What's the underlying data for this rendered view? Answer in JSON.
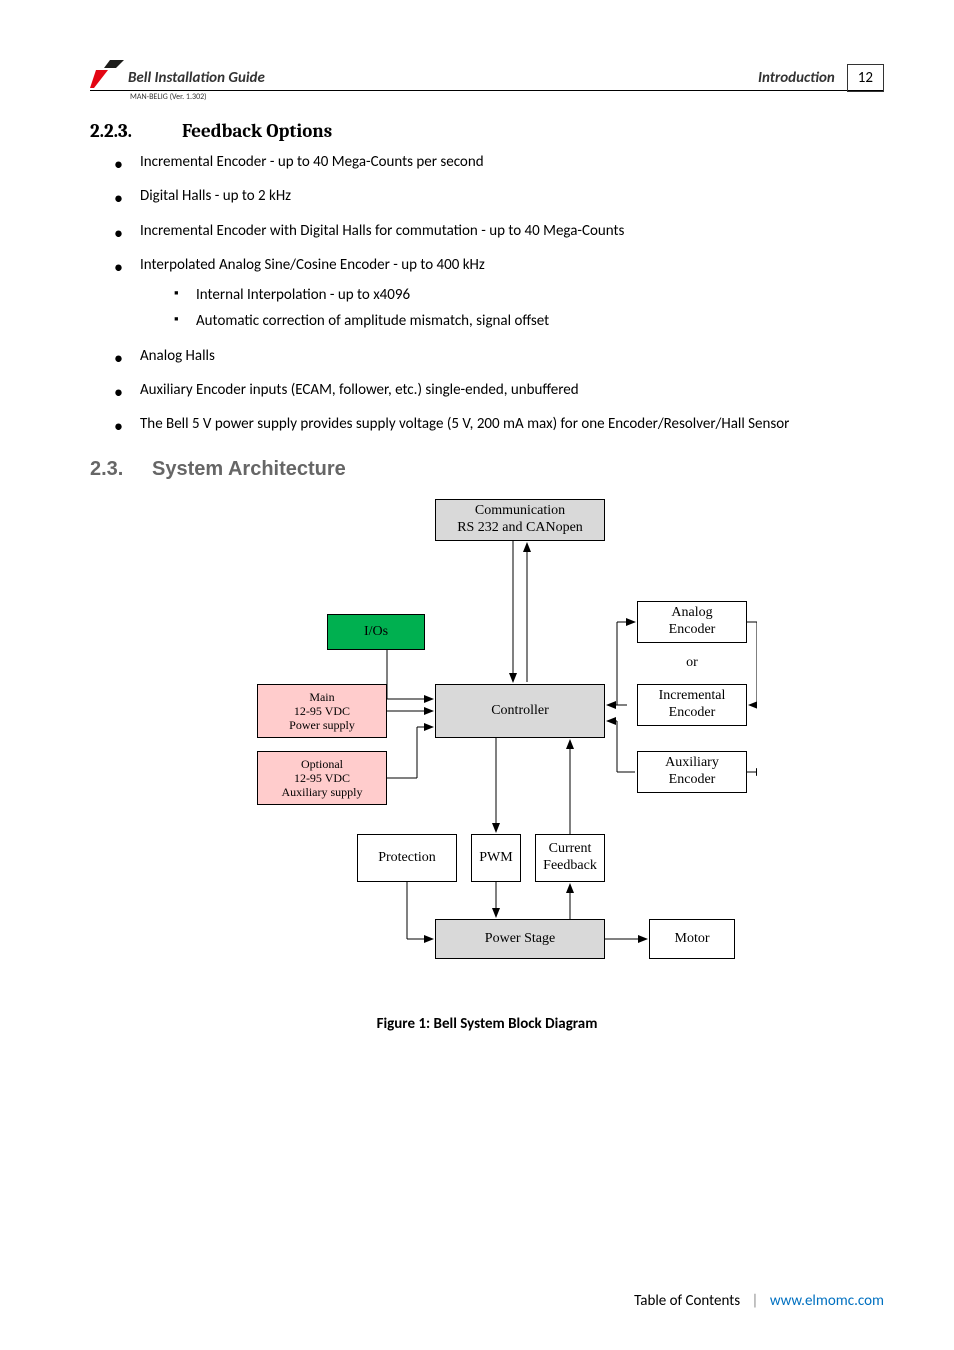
{
  "header": {
    "doc_title": "Bell Installation Guide",
    "section": "Introduction",
    "page_number": "12",
    "man_code": "MAN-BELIG (Ver. 1.302)"
  },
  "h3": {
    "number": "2.2.3.",
    "title": "Feedback Options"
  },
  "bullets": {
    "b1": "Incremental Encoder - up to 40 Mega-Counts per second",
    "b2": "Digital Halls - up to 2 kHz",
    "b3": "Incremental Encoder with Digital Halls for commutation - up to 40 Mega-Counts",
    "b4": "Interpolated Analog Sine/Cosine Encoder - up to 400 kHz",
    "b4_sub1": "Internal Interpolation - up to x4096",
    "b4_sub2": "Automatic correction of amplitude mismatch, signal offset",
    "b5": "Analog Halls",
    "b6": "Auxiliary Encoder inputs (ECAM, follower, etc.) single-ended, unbuffered",
    "b7": "The Bell 5 V power supply provides supply voltage (5 V, 200 mA max) for one Encoder/Resolver/Hall Sensor"
  },
  "h2": {
    "number": "2.3.",
    "title": "System Architecture"
  },
  "diagram": {
    "comm_line1": "Communication",
    "comm_line2": "RS 232 and CANopen",
    "ios": "I/Os",
    "main_l1": "Main",
    "main_l2": "12-95 VDC",
    "main_l3": "Power supply",
    "opt_l1": "Optional",
    "opt_l2": "12-95 VDC",
    "opt_l3": "Auxiliary supply",
    "protection": "Protection",
    "controller": "Controller",
    "pwm": "PWM",
    "current_fb_l1": "Current",
    "current_fb_l2": "Feedback",
    "power_stage": "Power Stage",
    "analog_enc_l1": "Analog",
    "analog_enc_l2": "Encoder",
    "or": "or",
    "inc_enc_l1": "Incremental",
    "inc_enc_l2": "Encoder",
    "aux_enc_l1": "Auxiliary",
    "aux_enc_l2": "Encoder",
    "motor": "Motor"
  },
  "figure_caption": "Figure 1: Bell System Block Diagram",
  "footer": {
    "toc": "Table of Contents",
    "link": "www.elmomc.com"
  }
}
